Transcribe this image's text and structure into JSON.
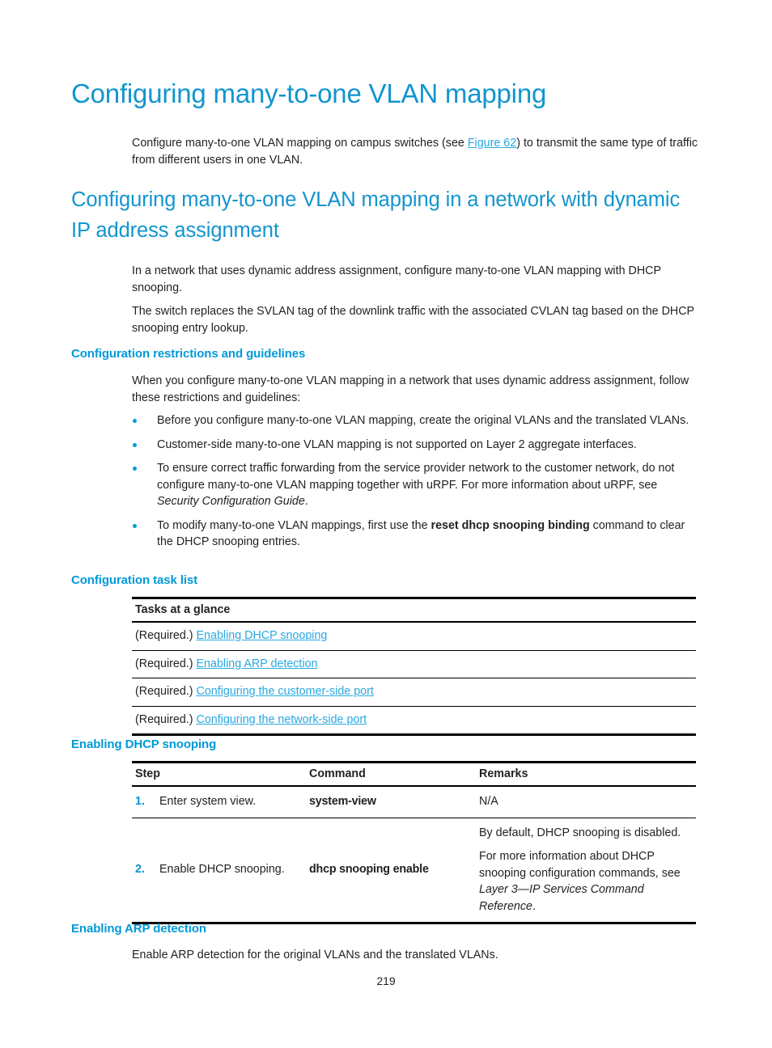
{
  "document": {
    "h1_title": "Configuring many-to-one VLAN mapping",
    "intro_before_link": "Configure many-to-one VLAN mapping on campus switches (see ",
    "intro_link": "Figure 62",
    "intro_after_link": ") to transmit the same type of traffic from different users in one VLAN.",
    "h2_title": "Configuring many-to-one VLAN mapping in a network with dynamic IP address assignment",
    "para_dynamic_1": "In a network that uses dynamic address assignment, configure many-to-one VLAN mapping with DHCP snooping.",
    "para_dynamic_2": "The switch replaces the SVLAN tag of the downlink traffic with the associated CVLAN tag based on the DHCP snooping entry lookup.",
    "page_number": "219"
  },
  "restrictions": {
    "heading": "Configuration restrictions and guidelines",
    "intro": "When you configure many-to-one VLAN mapping in a network that uses dynamic address assignment, follow these restrictions and guidelines:",
    "bullets": [
      {
        "text": "Before you configure many-to-one VLAN mapping, create the original VLANs and the translated VLANs."
      },
      {
        "text": "Customer-side many-to-one VLAN mapping is not supported on Layer 2 aggregate interfaces."
      },
      {
        "pre": "To ensure correct traffic forwarding from the service provider network to the customer network, do not configure many-to-one VLAN mapping together with uRPF. For more information about uRPF, see ",
        "italic": "Security Configuration Guide",
        "post": "."
      },
      {
        "pre": "To modify many-to-one VLAN mappings, first use the ",
        "bold": "reset dhcp snooping binding",
        "post": " command to clear the DHCP snooping entries."
      }
    ]
  },
  "task_list": {
    "heading": "Configuration task list",
    "column_header": "Tasks at a glance",
    "rows": [
      {
        "prefix": "(Required.) ",
        "link": "Enabling DHCP snooping"
      },
      {
        "prefix": "(Required.) ",
        "link": "Enabling ARP detection"
      },
      {
        "prefix": "(Required.) ",
        "link": "Configuring the customer-side port"
      },
      {
        "prefix": "(Required.) ",
        "link": "Configuring the network-side port"
      }
    ]
  },
  "dhcp_snooping": {
    "heading": "Enabling DHCP snooping",
    "columns": [
      "Step",
      "Command",
      "Remarks"
    ],
    "rows": [
      {
        "number": "1.",
        "step": "Enter system view.",
        "command": "system-view",
        "remarks": [
          "N/A"
        ]
      },
      {
        "number": "2.",
        "step": "Enable DHCP snooping.",
        "command": "dhcp snooping enable",
        "remarks_1": "By default, DHCP snooping is disabled.",
        "remarks_2_pre": "For more information about DHCP snooping configuration commands, see ",
        "remarks_2_italic": "Layer 3—IP Services Command Reference",
        "remarks_2_post": "."
      }
    ]
  },
  "arp_detection": {
    "heading": "Enabling ARP detection",
    "body": "Enable ARP detection for the original VLANs and the translated VLANs."
  },
  "colors": {
    "h1": "#1295cf",
    "h2": "#1295cf",
    "h3": "#0099d8",
    "link": "#29a8e0",
    "step_number": "#0096d6",
    "body_text": "#231f20"
  }
}
